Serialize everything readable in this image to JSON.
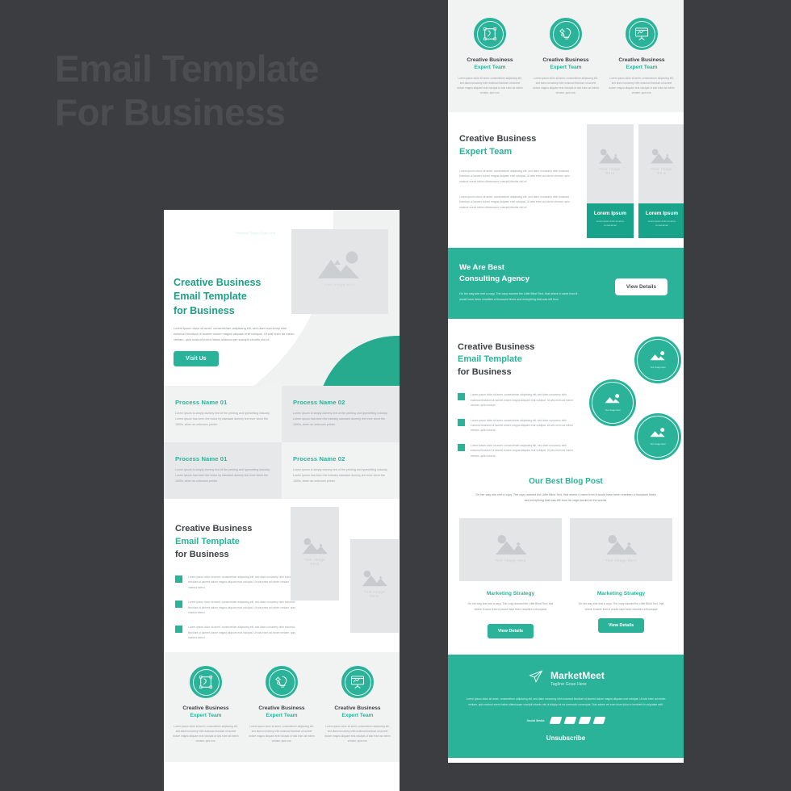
{
  "backdrop": {
    "title": "Email Template\nFor Business"
  },
  "colors": {
    "teal": "#2bb39a",
    "teal_dark": "#17a48a",
    "heading": "#3d4245",
    "body": "#9aa0a3",
    "bg": "#3b3d40"
  },
  "placeholder": {
    "label": "Your Image Here"
  },
  "hero": {
    "logo": {
      "name": "Marketogo",
      "tagline": "Business Slogan Goes Here",
      "icon": "presentation-icon"
    },
    "heading": "Creative Business\nEmail Template\nfor Business",
    "paragraph": "Lorem ipsum dolor sit amet, consectetuer adipiscing elit, sed diam nonummy nibh euismod tincidunt ut laoreet dolore magna aliquam erat volutpat. Ut wisi enim ad minim veniam, quis nostrud exerci tation ullamcorper suscipit lobortis nisl ut.",
    "button": "Visit Us"
  },
  "process": [
    {
      "title": "Process Name 01",
      "text": "Lorem ipsum is simply dummy text of the printing and typesetting industry. Lorem ipsum has been the indus try standard dummy text ever since the 1500s, when an unknown printer."
    },
    {
      "title": "Process Name 02",
      "text": "Lorem ipsum is simply dummy text of the printing and typesetting industry. Lorem ipsum has been the industry standard dummy text ever since the 1500s, when an unknown printer."
    },
    {
      "title": "Process Name 01",
      "text": "Lorem ipsum is simply dummy text of the printing and typesetting industry. Lorem ipsum has been the indus try standard dummy text ever since the 1500s, when an unknown printer."
    },
    {
      "title": "Process Name 02",
      "text": "Lorem ipsum is simply dummy text of the printing and typesetting industry. Lorem ipsum has been the industry standard dummy text ever since the 1500s, when an unknown printer."
    }
  ],
  "feature_left": {
    "heading_line1": "Creative Business",
    "heading_line2": "Email Template",
    "heading_line3": "for Business",
    "bullets": [
      "Lorem ipsum dolor sit amet, consectetuer adipiscing elit, sed diam nonummy nibh euismod tincidunt ut laoreet dolore magna aliquam erat volutpat. Ut wisi enim ad minim veniam, quis nostrud exerci.",
      "Lorem ipsum dolor sit amet, consectetuer adipiscing elit, sed diam nonummy nibh euismod tincidunt ut laoreet dolore magna aliquam erat volutpat. Ut wisi enim ad minim veniam, quis nostrud exerci.",
      "Lorem ipsum dolor sit amet, consectetuer adipiscing elit, sed diam nonummy nibh euismod tincidunt ut laoreet dolore magna aliquam erat volutpat. Ut wisi enim ad minim veniam, quis nostrud exerci."
    ]
  },
  "icon_cards": [
    {
      "icon": "pen-tool-icon",
      "title1": "Creative Business",
      "title2": "Expert Team",
      "text": "Lorem ipsum dolor sit amet, consectetuer adipiscing elit, sed diam nonummy nibh euismod tincidunt ut laoreet dolore magna aliquam erat volutpat ut wisi enim ad minim veniam, quis nos."
    },
    {
      "icon": "lightbulb-gear-icon",
      "title1": "Creative Business",
      "title2": "Expert Team",
      "text": "Lorem ipsum dolor sit amet, consectetuer adipiscing elit, sed diam nonummy nibh euismod tincidunt ut laoreet dolore magna aliquam erat volutpat ut wisi enim ad minim veniam, quis nos."
    },
    {
      "icon": "presentation-chart-icon",
      "title1": "Creative Business",
      "title2": "Expert Team",
      "text": "Lorem ipsum dolor sit amet, consectetuer adipiscing elit, sed diam nonummy nibh euismod tincidunt ut laoreet dolore magna aliquam erat volutpat ut wisi enim ad minim veniam, quis nos."
    }
  ],
  "team": {
    "heading_line1": "Creative Business",
    "heading_line2": "Expert Team",
    "paragraph1": "Lorem ipsum dolor sit amet, consectetuer adipiscing elit, sed diam nonummy nibh euismod tincidunt ut laoreet dolore magna aliquam erat volutpat. Ut wisi enim ad minim veniam, quis nostrud exerci tation ullamcorper suscipit lobortis nisl ut.",
    "paragraph2": "Lorem ipsum dolor sit amet, consectetuer adipiscing elit, sed diam nonummy nibh euismod tincidunt ut laoreet dolore magna aliquam erat volutpat. Ut wisi enim ad minim veniam, quis nostrud exerci tation ullamcorper suscipit lobortis nisl ut.",
    "cards": [
      {
        "name": "Lorem Ipsum",
        "role": "Lorem ipsum dolor sit amet, consectetuer"
      },
      {
        "name": "Lorem Ipsum",
        "role": "Lorem ipsum dolor sit amet, consectetuer"
      }
    ]
  },
  "cta": {
    "heading": "We Are Best\nConsulting Agency",
    "text": "On her way she met a copy. The copy warned the Little Blind Text, that where it came from it would have been rewritten a thousand times and everything that was left from",
    "button": "View Details"
  },
  "circle_feature": {
    "heading_line1": "Creative Business",
    "heading_line2": "Email Template",
    "heading_line3": "for Business",
    "bullets": [
      "Lorem ipsum dolor sit amet, consectetuer adipiscing elit, sed diam nonummy nibh euismod tincidunt ut laoreet dolore magna aliquam erat volutpat. Ut wisi enim ad minim veniam, quis nostrud.",
      "Lorem ipsum dolor sit amet, consectetuer adipiscing elit, sed diam nonummy nibh euismod tincidunt ut laoreet dolore magna aliquam erat volutpat. Ut wisi enim ad minim veniam, quis nostrud.",
      "Lorem ipsum dolor sit amet, consectetuer adipiscing elit, sed diam nonummy nibh euismod tincidunt ut laoreet dolore magna aliquam erat volutpat. Ut wisi enim ad minim veniam, quis nostrud."
    ]
  },
  "blog": {
    "title": "Our Best Blog Post",
    "subtitle": "On her way she met a copy. The copy warned the Little Blind Text, that where it came from it would have been rewritten a thousand times and everything that was left from its origin would be the wordsi.",
    "cards": [
      {
        "title": "Marketing Strategy",
        "text": "On her way she met a copy. The copy warned the Little Blind Text, that where it came from it would have been rewritten a thousand",
        "button": "View Details"
      },
      {
        "title": "Marketing Strategy",
        "text": "On her way she met a copy. The copy warned the Little Blind Text, that where it came from it would have been rewritten a thousand",
        "button": "View Details"
      }
    ]
  },
  "footer": {
    "icon": "paper-plane-icon",
    "brand": "MarketMeet",
    "tagline": "Tagline Gose Here",
    "text": "Lorem ipsum dolor sit amet, consectetuer adipiscing elit, sed diam nonummy nibh euismod tincidunt ut laoreet dolore magna aliquam erat volutpat. Ut wisi enim ad minim veniam, quis nostrud exerci tation ullamcorper suscipit lobortis nisl ut aliquip ex ea commodo consequat. Duis autem vel eum iriure dolor in hendrerit in vulputate velit.",
    "social_label": "Social Media",
    "social_count": 4,
    "unsubscribe": "Unsubscribe"
  }
}
